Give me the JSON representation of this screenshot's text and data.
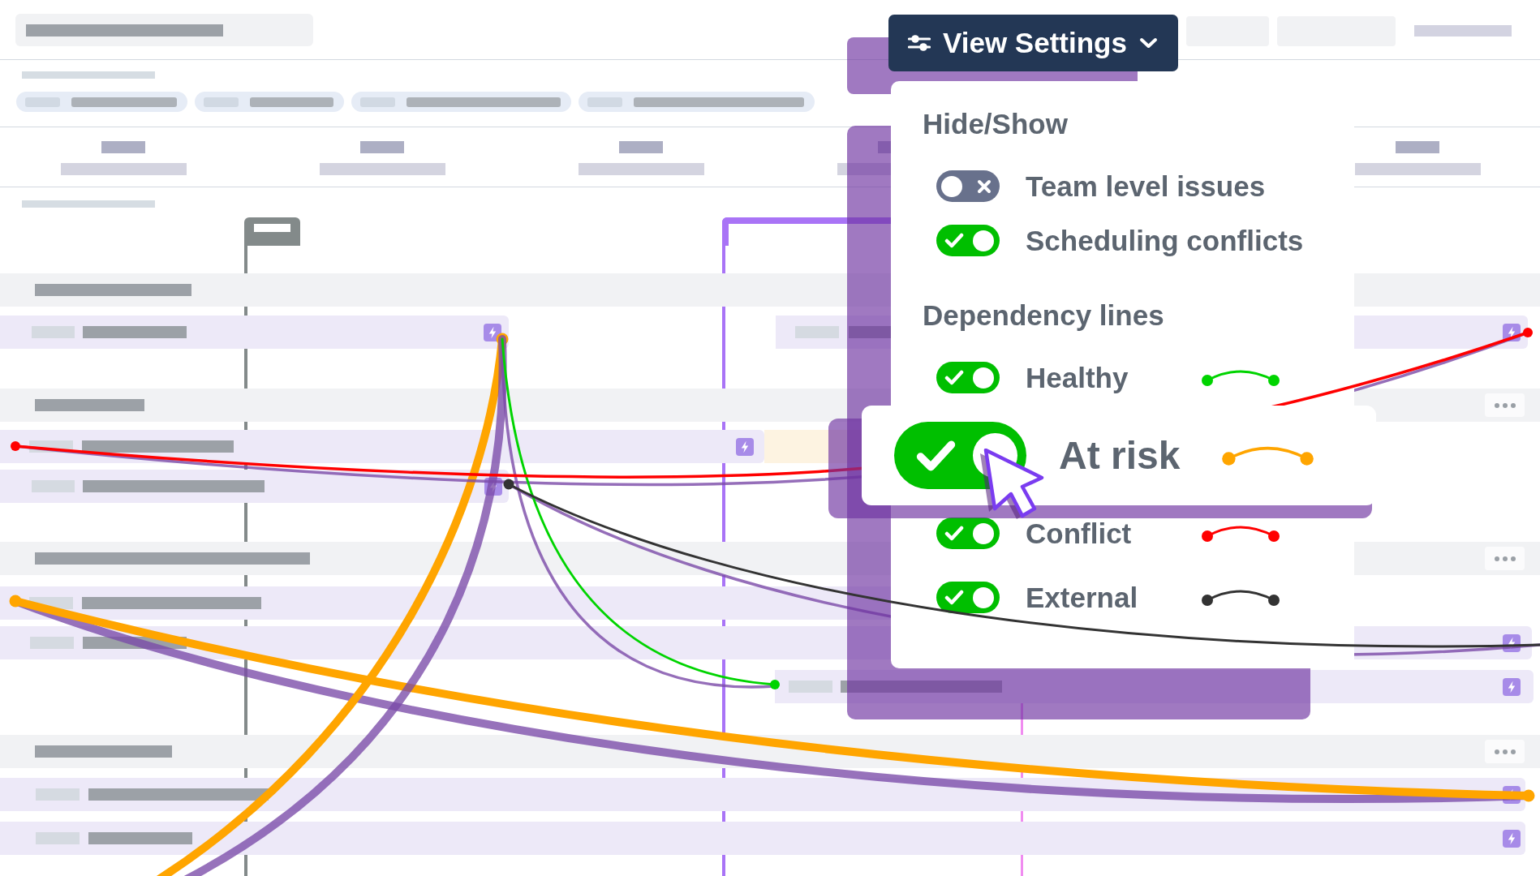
{
  "view_settings": {
    "title": "View Settings",
    "expanded": true,
    "sections": [
      {
        "heading": "Hide/Show",
        "items": [
          {
            "label": "Team level issues",
            "on": false,
            "highlighted": false
          },
          {
            "label": "Scheduling conflicts",
            "on": true,
            "highlighted": false
          }
        ]
      },
      {
        "heading": "Dependency lines",
        "items": [
          {
            "label": "Healthy",
            "on": true,
            "highlighted": false,
            "color": "#00d400"
          },
          {
            "label": "At risk",
            "on": true,
            "highlighted": true,
            "color": "#ffa500"
          },
          {
            "label": "Conflict",
            "on": true,
            "highlighted": false,
            "color": "#ff0000"
          },
          {
            "label": "External",
            "on": true,
            "highlighted": false,
            "color": "#333333"
          }
        ]
      }
    ]
  }
}
